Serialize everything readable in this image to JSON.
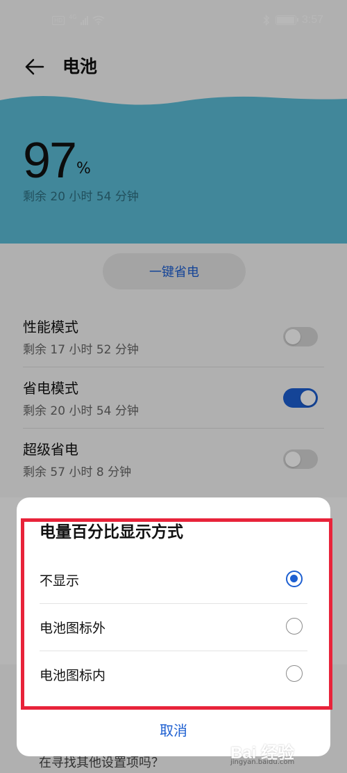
{
  "status_bar": {
    "network_badge": "HD",
    "network_type": "4G",
    "time": "3:57",
    "icons": [
      "hd-icon",
      "signal-icon",
      "wifi-icon",
      "bluetooth-icon",
      "battery-icon"
    ]
  },
  "header": {
    "title": "电池",
    "back_icon": "arrow-left-icon"
  },
  "battery": {
    "percent": "97",
    "percent_unit": "%",
    "remaining": "剩余 20 小时 54 分钟",
    "wave_color": "#5bbcd6"
  },
  "one_key_save": {
    "label": "一键省电"
  },
  "modes": [
    {
      "title": "性能模式",
      "subtitle": "剩余 17 小时 52 分钟",
      "enabled": false
    },
    {
      "title": "省电模式",
      "subtitle": "剩余 20 小时 54 分钟",
      "enabled": true
    },
    {
      "title": "超级省电",
      "subtitle": "剩余 57 小时 8 分钟",
      "enabled": false
    }
  ],
  "dialog": {
    "title": "电量百分比显示方式",
    "options": [
      {
        "label": "不显示",
        "selected": true
      },
      {
        "label": "电池图标外",
        "selected": false
      },
      {
        "label": "电池图标内",
        "selected": false
      }
    ],
    "cancel_label": "取消"
  },
  "footer": {
    "search_hint": "在寻找其他设置项吗？"
  },
  "watermark": {
    "text": "Bai 经验",
    "sub": "jingyan.baidu.com"
  },
  "colors": {
    "accent": "#1d5fd1",
    "highlight": "#e8233a",
    "wave": "#5bbcd6"
  }
}
